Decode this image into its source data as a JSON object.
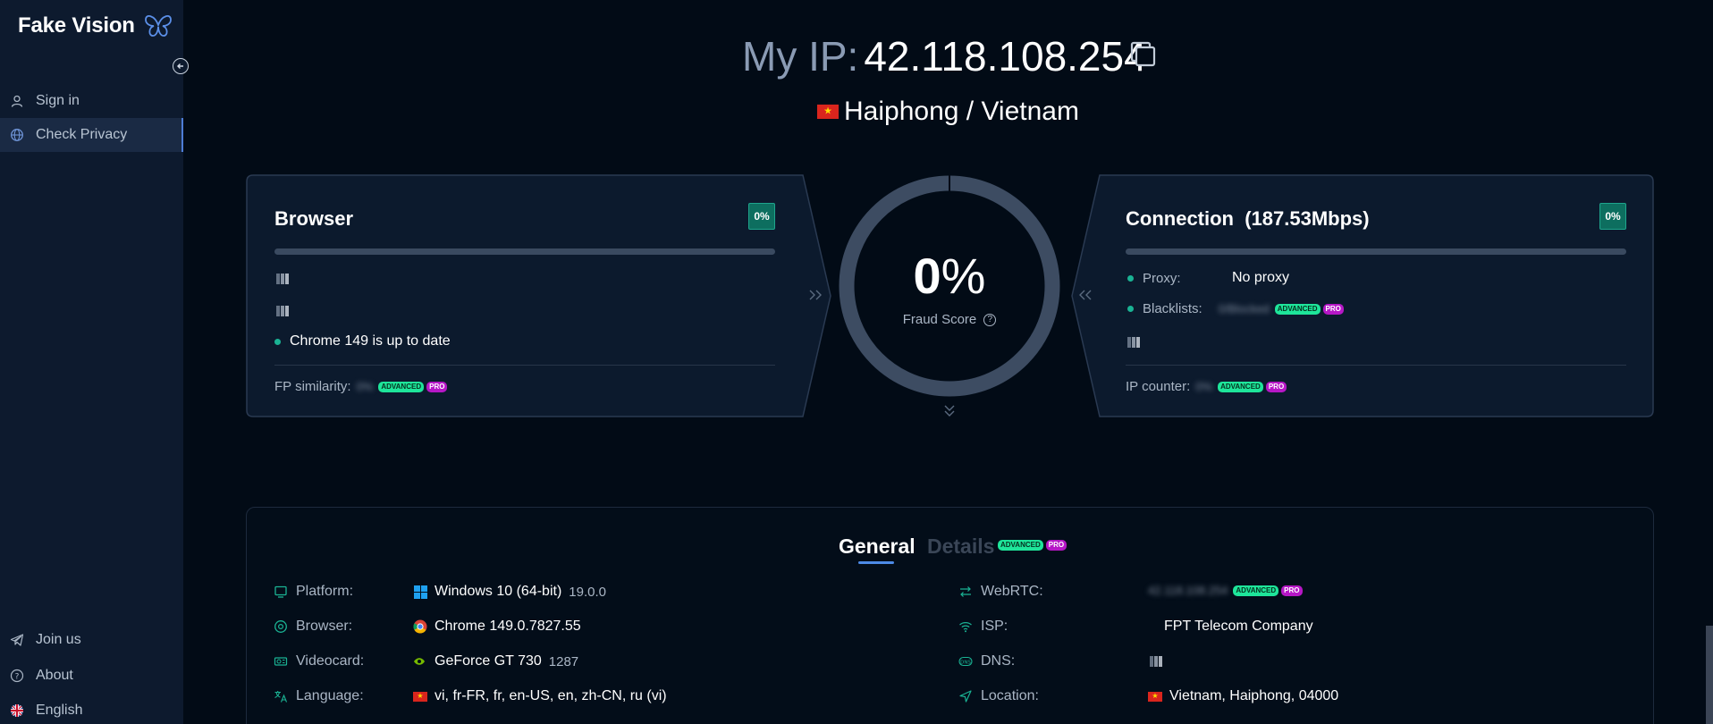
{
  "sidebar": {
    "brand": "Fake Vision",
    "items": [
      {
        "label": "Sign in",
        "icon": "user-icon"
      },
      {
        "label": "Check Privacy",
        "icon": "globe-icon",
        "active": true
      }
    ],
    "bottom": [
      {
        "label": "Join us",
        "icon": "telegram-icon"
      },
      {
        "label": "About",
        "icon": "help-icon"
      },
      {
        "label": "English",
        "icon": "uk-flag-icon"
      }
    ]
  },
  "header": {
    "ip_label": "My IP:",
    "ip": "42.118.108.254",
    "location": "Haiphong / Vietnam"
  },
  "browser_card": {
    "title": "Browser",
    "score": "0%",
    "status": "Chrome 149 is up to date",
    "fp_label": "FP similarity:",
    "fp_value": "0%"
  },
  "gauge": {
    "value": "0",
    "unit": "%",
    "label": "Fraud Score",
    "fraction": 0.0
  },
  "connection_card": {
    "title": "Connection",
    "speed": "(187.53Mbps)",
    "score": "0%",
    "proxy_label": "Proxy:",
    "proxy_value": "No proxy",
    "blacklists_label": "Blacklists:",
    "blacklists_value": "0/Blocked",
    "ip_counter_label": "IP counter:",
    "ip_counter_value": "0%"
  },
  "badges": {
    "advanced": "ADVANCED",
    "pro": "PRO"
  },
  "tabs": {
    "general": "General",
    "details": "Details"
  },
  "general": {
    "left": [
      {
        "label": "Platform:",
        "value": "Windows 10 (64-bit)",
        "extra": "19.0.0"
      },
      {
        "label": "Browser:",
        "value": "Chrome 149.0.7827.55",
        "extra": ""
      },
      {
        "label": "Videocard:",
        "value": "GeForce GT 730",
        "extra": "1287"
      },
      {
        "label": "Language:",
        "value": "vi, fr-FR, fr, en-US, en, zh-CN, ru (vi)",
        "extra": ""
      }
    ],
    "right": [
      {
        "label": "WebRTC:",
        "value": "42.118.108.254"
      },
      {
        "label": "ISP:",
        "value": "FPT Telecom Company"
      },
      {
        "label": "DNS:",
        "value": ""
      },
      {
        "label": "Location:",
        "value": "Vietnam, Haiphong, 04000"
      }
    ]
  },
  "colors": {
    "background": "#020b16",
    "sidebar": "#0d1a2e",
    "accent_green": "#1ab394",
    "badge_advanced": "#1ee59a",
    "badge_pro": "#b617c6",
    "tab_underline": "#4d8ae6"
  }
}
